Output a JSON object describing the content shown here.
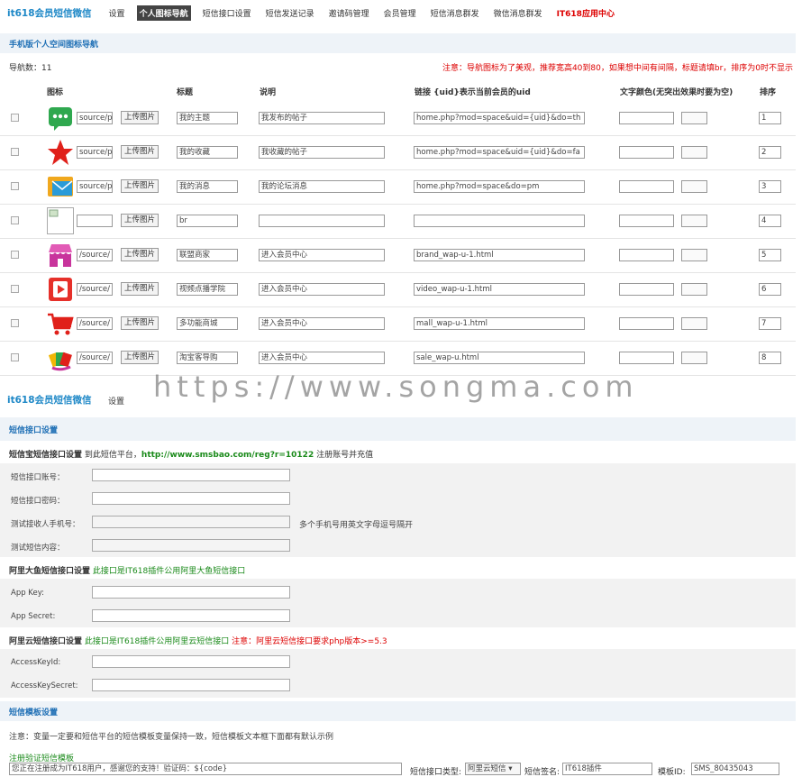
{
  "topnav": {
    "brand": "it618会员短信微信",
    "items": [
      "设置",
      "个人图标导航",
      "短信接口设置",
      "短信发送记录",
      "邀请码管理",
      "会员管理",
      "短信消息群发",
      "微信消息群发",
      "IT618应用中心"
    ]
  },
  "section1": {
    "title": "手机版个人空间图标导航",
    "count_label": "导航数：11",
    "note": "注意：导航图标为了美观，推荐宽高40到80，如果想中间有间隔，标题请填br，排序为0时不显示",
    "headers": {
      "icon": "图标",
      "title": "标题",
      "desc": "说明",
      "link": "链接 {uid}表示当前会员的uid",
      "color": "文字颜色(无突出效果时要为空)",
      "sort": "排序"
    },
    "upload_label": "上传图片",
    "rows": [
      {
        "icon": "chat-icon",
        "path": "source/p",
        "title": "我的主题",
        "desc": "我发布的帖子",
        "link": "home.php?mod=space&uid={uid}&do=th",
        "sort": "1"
      },
      {
        "icon": "star-icon",
        "path": "source/p",
        "title": "我的收藏",
        "desc": "我收藏的帖子",
        "link": "home.php?mod=space&uid={uid}&do=fa",
        "sort": "2"
      },
      {
        "icon": "envelope-icon",
        "path": "source/p",
        "title": "我的消息",
        "desc": "我的论坛消息",
        "link": "home.php?mod=space&do=pm",
        "sort": "3"
      },
      {
        "icon": "broken-image-icon",
        "path": "",
        "title": "br",
        "desc": "",
        "link": "",
        "sort": "4"
      },
      {
        "icon": "shop-icon",
        "path": "/source/",
        "title": "联盟商家",
        "desc": "进入会员中心",
        "link": "brand_wap-u-1.html",
        "sort": "5"
      },
      {
        "icon": "video-icon",
        "path": "/source/",
        "title": "视频点播学院",
        "desc": "进入会员中心",
        "link": "video_wap-u-1.html",
        "sort": "6"
      },
      {
        "icon": "cart-icon",
        "path": "/source/",
        "title": "多功能商城",
        "desc": "进入会员中心",
        "link": "mall_wap-u-1.html",
        "sort": "7"
      },
      {
        "icon": "bags-icon",
        "path": "/source/",
        "title": "淘宝客导购",
        "desc": "进入会员中心",
        "link": "sale_wap-u.html",
        "sort": "8"
      }
    ]
  },
  "subnav": {
    "brand": "it618会员短信微信",
    "item": "设置"
  },
  "watermark": "https://www.songma.com",
  "section2": {
    "title": "短信接口设置",
    "smsbao_title": "短信宝短信接口设置",
    "smsbao_reg": "到此短信平台，",
    "smsbao_url": "http://www.smsbao.com/reg?r=10122",
    "smsbao_tail": "注册账号并充值",
    "fields": [
      "短信接口账号：",
      "短信接口密码：",
      "测试接收人手机号：",
      "测试短信内容："
    ],
    "phone_hint": "多个手机号用英文字母逗号隔开",
    "alidayu_title": "阿里大鱼短信接口设置",
    "alidayu_note": "此接口是IT618插件公用阿里大鱼短信接口",
    "alidayu_fields": [
      "App Key:",
      "App Secret:"
    ],
    "aliyun_title": "阿里云短信接口设置",
    "aliyun_note": "此接口是IT618插件公用阿里云短信接口",
    "aliyun_warn": "注意：阿里云短信接口要求php版本>=5.3",
    "aliyun_fields": [
      "AccessKeyId:",
      "AccessKeySecret:"
    ]
  },
  "section3": {
    "title": "短信模板设置",
    "note": "注意：变量一定要和短信平台的短信模板变量保持一致，短信模板文本框下面都有默认示例",
    "tpl_label": "注册验证短信模板",
    "tpl_value": "您正在注册成为IT618用户，感谢您的支持！验证码：${code}",
    "type_label": "短信接口类型:",
    "type_value": "阿里云短信",
    "sign_label": "短信签名:",
    "sign_value": "IT618插件",
    "tplid_label": "模板ID:",
    "tplid_value": "SMS_80435043"
  }
}
